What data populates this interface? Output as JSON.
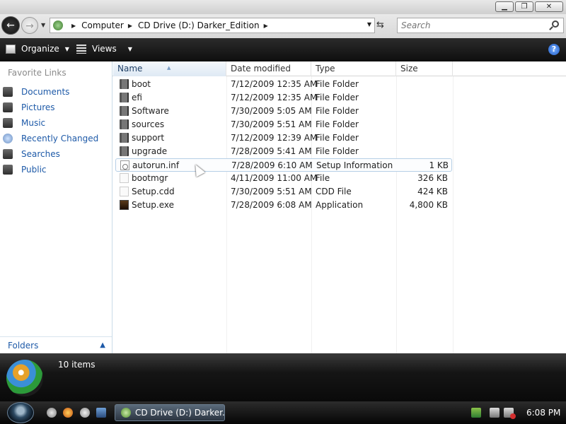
{
  "window": {
    "minimize_label": "▁",
    "maximize_label": "❐",
    "close_label": "✕"
  },
  "address": {
    "crumbs": [
      "Computer",
      "CD Drive (D:) Darker_Edition"
    ],
    "search_placeholder": "Search"
  },
  "toolbar": {
    "organize_label": "Organize",
    "views_label": "Views",
    "help_label": "?"
  },
  "nav": {
    "favorite_links_title": "Favorite Links",
    "items": [
      {
        "label": "Documents",
        "icon": "documents-icon"
      },
      {
        "label": "Pictures",
        "icon": "pictures-icon"
      },
      {
        "label": "Music",
        "icon": "music-icon"
      },
      {
        "label": "Recently Changed",
        "icon": "recently-changed-icon"
      },
      {
        "label": "Searches",
        "icon": "searches-icon"
      },
      {
        "label": "Public",
        "icon": "public-icon"
      }
    ],
    "folders_label": "Folders"
  },
  "columns": {
    "name": "Name",
    "modified": "Date modified",
    "type": "Type",
    "size": "Size"
  },
  "files": [
    {
      "name": "boot",
      "modified": "7/12/2009 12:35 AM",
      "type": "File Folder",
      "size": "",
      "icon": "folder-icon"
    },
    {
      "name": "efi",
      "modified": "7/12/2009 12:35 AM",
      "type": "File Folder",
      "size": "",
      "icon": "folder-icon"
    },
    {
      "name": "Software",
      "modified": "7/30/2009 5:05 AM",
      "type": "File Folder",
      "size": "",
      "icon": "folder-icon"
    },
    {
      "name": "sources",
      "modified": "7/30/2009 5:51 AM",
      "type": "File Folder",
      "size": "",
      "icon": "folder-icon"
    },
    {
      "name": "support",
      "modified": "7/12/2009 12:39 AM",
      "type": "File Folder",
      "size": "",
      "icon": "folder-icon"
    },
    {
      "name": "upgrade",
      "modified": "7/28/2009 5:41 AM",
      "type": "File Folder",
      "size": "",
      "icon": "folder-icon"
    },
    {
      "name": "autorun.inf",
      "modified": "7/28/2009 6:10 AM",
      "type": "Setup Information",
      "size": "1 KB",
      "icon": "setup-info-icon"
    },
    {
      "name": "bootmgr",
      "modified": "4/11/2009 11:00 AM",
      "type": "File",
      "size": "326 KB",
      "icon": "file-icon"
    },
    {
      "name": "Setup.cdd",
      "modified": "7/30/2009 5:51 AM",
      "type": "CDD File",
      "size": "424 KB",
      "icon": "file-icon"
    },
    {
      "name": "Setup.exe",
      "modified": "7/28/2009 6:08 AM",
      "type": "Application",
      "size": "4,800 KB",
      "icon": "application-icon"
    }
  ],
  "details": {
    "items_count": "10 items"
  },
  "taskbar": {
    "task_label": "CD Drive (D:) Darker...",
    "clock": "6:08 PM"
  }
}
